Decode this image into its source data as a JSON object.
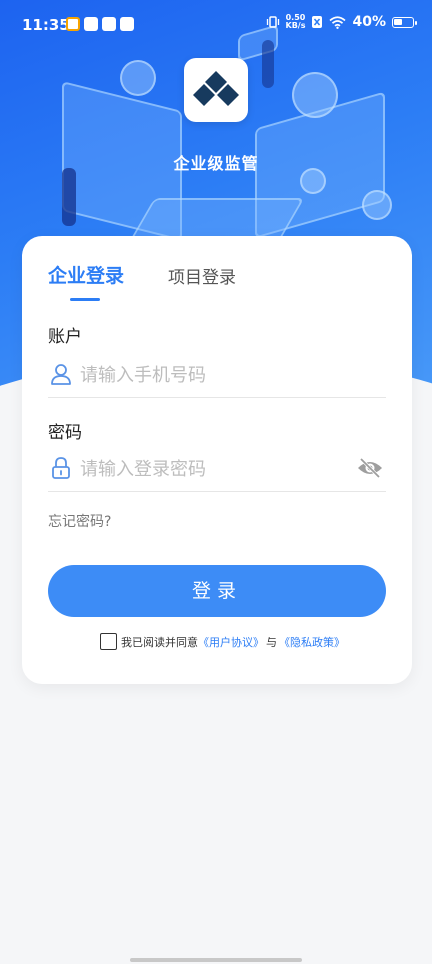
{
  "status_bar": {
    "time": "11:35",
    "net_speed_value": "0.50",
    "net_speed_unit": "KB/s",
    "battery": "40%"
  },
  "app": {
    "name": "企业级监管"
  },
  "tabs": [
    {
      "label": "企业登录",
      "active": true
    },
    {
      "label": "项目登录",
      "active": false
    }
  ],
  "account": {
    "label": "账户",
    "placeholder": "请输入手机号码"
  },
  "password": {
    "label": "密码",
    "placeholder": "请输入登录密码"
  },
  "forgot_label": "忘记密码?",
  "login_label": "登录",
  "agreement": {
    "prefix": "我已阅读并同意",
    "user_link": "《用户协议》",
    "conj": "与",
    "privacy_link": "《隐私政策》",
    "checked": false
  },
  "colors": {
    "primary": "#2c7df5",
    "button": "#3d8cf6",
    "hero_dark": "#1d63f0"
  }
}
